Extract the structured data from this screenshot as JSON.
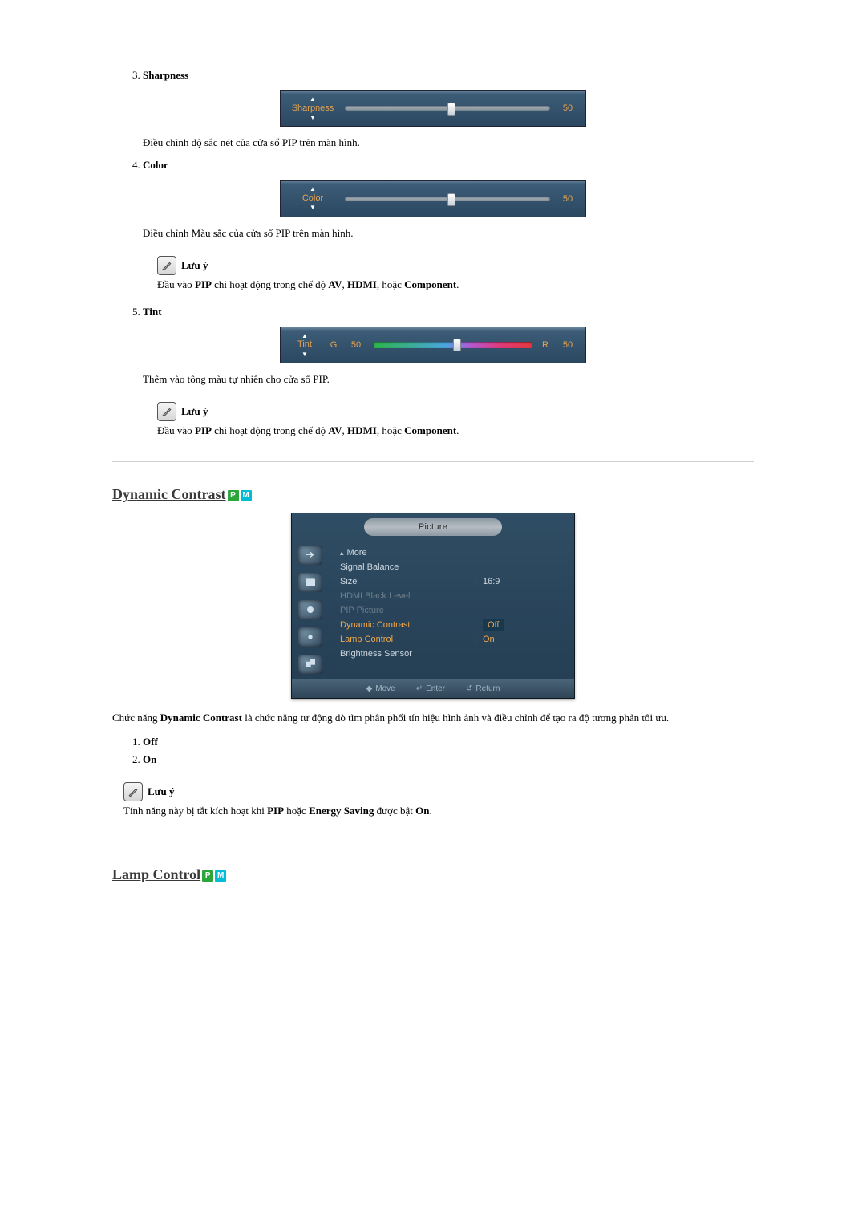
{
  "sharpness": {
    "number": "3.",
    "title": "Sharpness",
    "slider_label": "Sharpness",
    "value": "50",
    "knob_percent": 50,
    "desc": "Điều chỉnh độ sắc nét của cửa sổ PIP trên màn hình."
  },
  "color": {
    "number": "4.",
    "title": "Color",
    "slider_label": "Color",
    "value": "50",
    "knob_percent": 50,
    "desc": "Điều chỉnh Màu sắc của cửa sổ PIP trên màn hình."
  },
  "note1": {
    "title": "Lưu ý",
    "prefix": "Đầu vào ",
    "b1": "PIP",
    "mid1": " chỉ hoạt động trong chế độ ",
    "b2": "AV",
    "sep1": ", ",
    "b3": "HDMI",
    "sep2": ", hoặc ",
    "b4": "Component",
    "suffix": "."
  },
  "tint": {
    "number": "5.",
    "title": "Tint",
    "slider_label": "Tint",
    "left_letter": "G",
    "left_val": "50",
    "right_letter": "R",
    "right_val": "50",
    "knob_percent": 50,
    "desc": "Thêm vào tông màu tự nhiên cho cửa sổ PIP."
  },
  "note2": {
    "title": "Lưu ý",
    "prefix": "Đầu vào ",
    "b1": "PIP",
    "mid1": " chỉ hoạt động trong chế độ ",
    "b2": "AV",
    "sep1": ", ",
    "b3": "HDMI",
    "sep2": ", hoặc ",
    "b4": "Component",
    "suffix": "."
  },
  "dyn": {
    "heading": "Dynamic Contrast",
    "badge_p": "P",
    "badge_m": "M",
    "osd": {
      "title": "Picture",
      "more": "More",
      "rows": [
        {
          "label": "Signal Balance",
          "value": "",
          "state": "normal"
        },
        {
          "label": "Size",
          "value": "16:9",
          "state": "normal"
        },
        {
          "label": "HDMI Black Level",
          "value": "",
          "state": "disabled"
        },
        {
          "label": "PIP Picture",
          "value": "",
          "state": "disabled"
        },
        {
          "label": "Dynamic Contrast",
          "value": "Off",
          "state": "highlight",
          "boxed": true
        },
        {
          "label": "Lamp Control",
          "value": "On",
          "state": "highlight"
        },
        {
          "label": "Brightness Sensor",
          "value": "",
          "state": "normal"
        }
      ],
      "foot_move": "Move",
      "foot_enter": "Enter",
      "foot_return": "Return"
    },
    "body_pre": "Chức năng ",
    "body_b": "Dynamic Contrast",
    "body_post": " là chức năng tự động dò tìm phân phối tín hiệu hình ảnh và điều chỉnh để tạo ra độ tương phản tối ưu.",
    "opt1_num": "1.",
    "opt1": "Off",
    "opt2_num": "2.",
    "opt2": "On"
  },
  "note3": {
    "title": "Lưu ý",
    "prefix": "Tính năng này bị tắt kích hoạt khi ",
    "b1": "PIP",
    "mid1": " hoặc ",
    "b2": "Energy Saving",
    "mid2": " được bật ",
    "b3": "On",
    "suffix": "."
  },
  "lamp": {
    "heading": "Lamp Control",
    "badge_p": "P",
    "badge_m": "M"
  }
}
